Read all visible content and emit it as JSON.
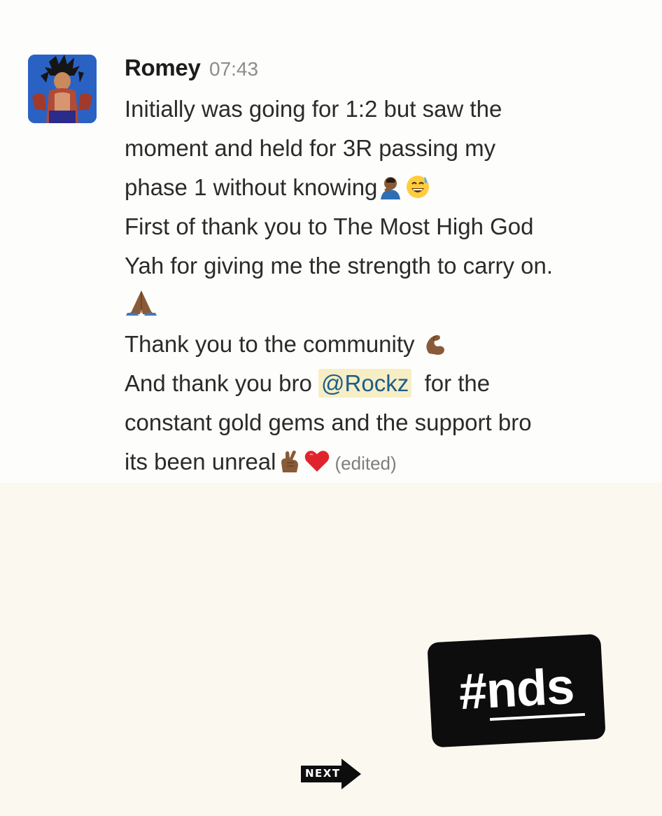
{
  "message": {
    "author": "Romey",
    "time": "07:43",
    "lines": [
      "Initially was going for 1:2 but saw the",
      "moment and held for 3R passing my",
      "phase 1 without knowing",
      "First of thank you to The Most High God",
      "Yah for giving me the strength to carry on.",
      "",
      "Thank you to the community",
      "And thank you bro",
      "for the",
      "constant gold gems and the support bro",
      "its been unreal"
    ],
    "mention": "@Rockz",
    "edited": "(edited)",
    "emojis": [
      "person-facepalming-icon",
      "grinning-sweat-icon",
      "folded-hands-icon",
      "flexed-biceps-icon",
      "crossed-fingers-icon",
      "red-heart-icon"
    ]
  },
  "badge": {
    "text": "#nds"
  },
  "next_button": {
    "label": "NEXT"
  },
  "colors": {
    "mention_bg": "#f7eec5",
    "mention_text": "#1b5e8c",
    "avatar_bg": "#1f57b8",
    "page_bg": "#fbf8ef"
  }
}
